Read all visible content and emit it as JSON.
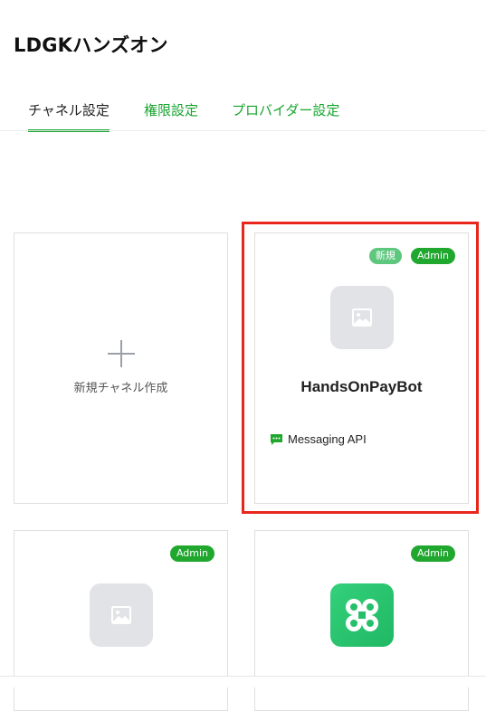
{
  "page": {
    "title": "LDGKハンズオン"
  },
  "tabs": [
    {
      "label": "チャネル設定",
      "active": true
    },
    {
      "label": "権限設定",
      "active": false
    },
    {
      "label": "プロバイダー設定",
      "active": false
    }
  ],
  "create_card": {
    "label": "新規チャネル作成",
    "icon": "plus-icon"
  },
  "channels": [
    {
      "name": "HandsOnPayBot",
      "badges": {
        "new": "新規",
        "admin": "Admin"
      },
      "type": "Messaging API",
      "icon": "image-placeholder-icon",
      "highlighted": true
    },
    {
      "badges": {
        "admin": "Admin"
      },
      "icon": "image-placeholder-icon"
    },
    {
      "badges": {
        "admin": "Admin"
      },
      "icon": "green-x-logo-icon"
    }
  ],
  "colors": {
    "accent": "#17a52f",
    "badge_admin": "#1fa72e",
    "badge_new": "#5ec77e",
    "highlight": "#e8261c",
    "thumb_bg": "#e1e3e6",
    "logo_bg": "#2ecc71"
  }
}
